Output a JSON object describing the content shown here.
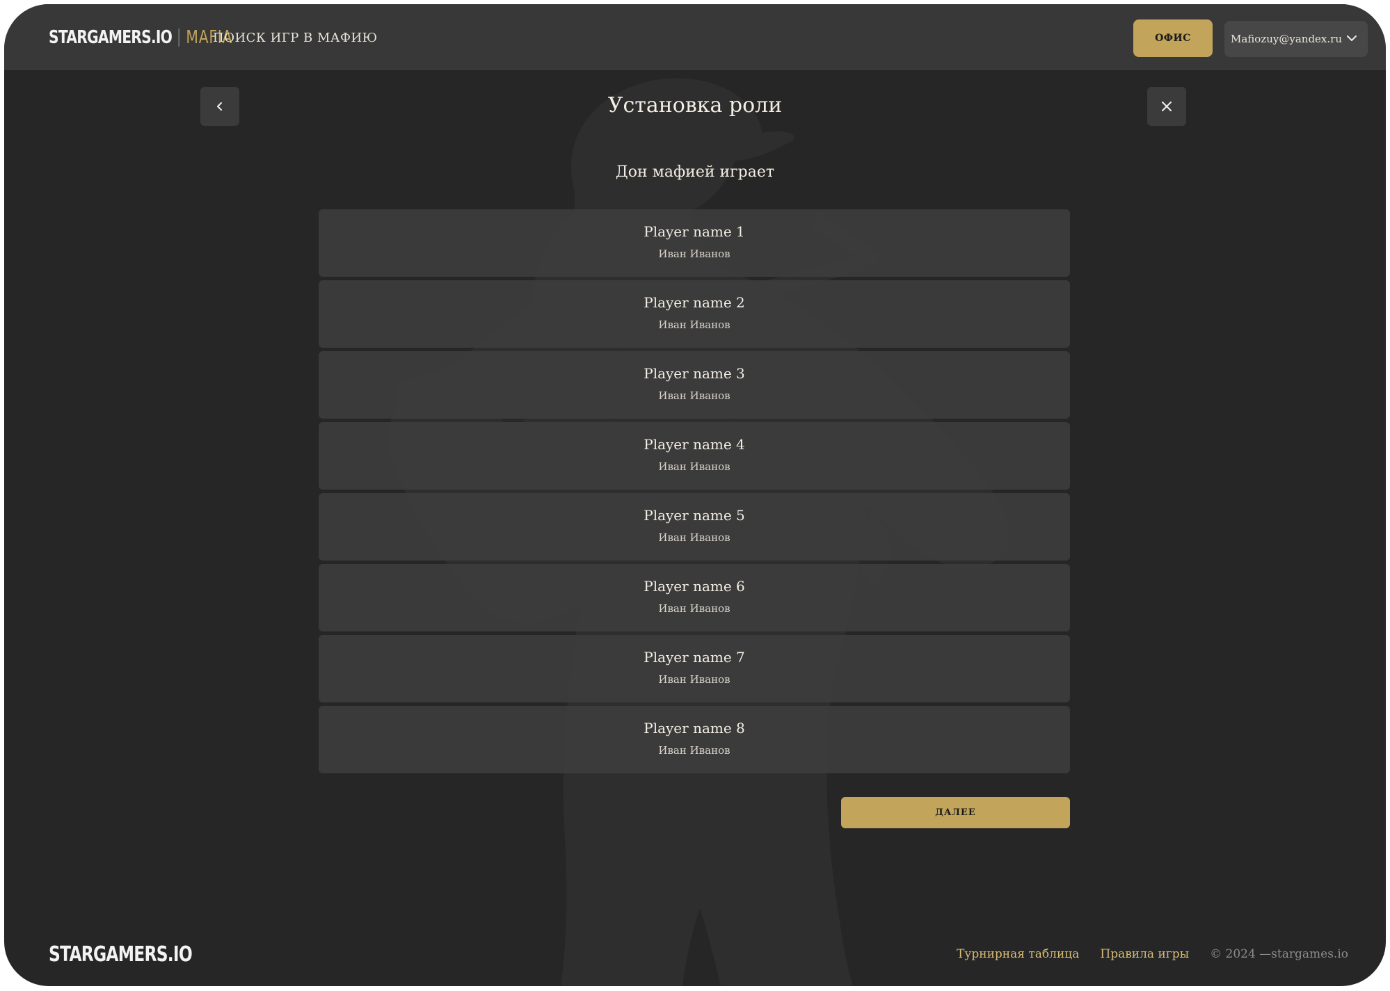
{
  "header": {
    "logo_main": "STARGAMERS.IO",
    "logo_accent": "MAFIA",
    "nav_search_games": "ПОИСК ИГР В МАФИЮ",
    "office_button": "ОФИС",
    "user_email": "Mafiozuy@yandex.ru"
  },
  "dialog": {
    "title": "Установка роли",
    "subtitle": "Дон мафией играет",
    "players": [
      {
        "name": "Player name 1",
        "real_name": "Иван Иванов"
      },
      {
        "name": "Player name 2",
        "real_name": "Иван Иванов"
      },
      {
        "name": "Player name 3",
        "real_name": "Иван Иванов"
      },
      {
        "name": "Player name 4",
        "real_name": "Иван Иванов"
      },
      {
        "name": "Player name 5",
        "real_name": "Иван Иванов"
      },
      {
        "name": "Player name 6",
        "real_name": "Иван Иванов"
      },
      {
        "name": "Player name 7",
        "real_name": "Иван Иванов"
      },
      {
        "name": "Player name 8",
        "real_name": "Иван Иванов"
      }
    ],
    "next_button": "ДАЛЕЕ"
  },
  "footer": {
    "logo": "STARGAMERS.IO",
    "links": [
      "Турнирная таблица",
      "Правила игры"
    ],
    "copyright": "© 2024 —stargames.io"
  },
  "colors": {
    "background": "#262626",
    "header": "#383838",
    "accent_gold": "#c2a55a",
    "row": "#3e3e3e"
  },
  "icons": {
    "back": "chevron-left-icon",
    "close": "close-icon",
    "dropdown": "chevron-down-icon"
  }
}
